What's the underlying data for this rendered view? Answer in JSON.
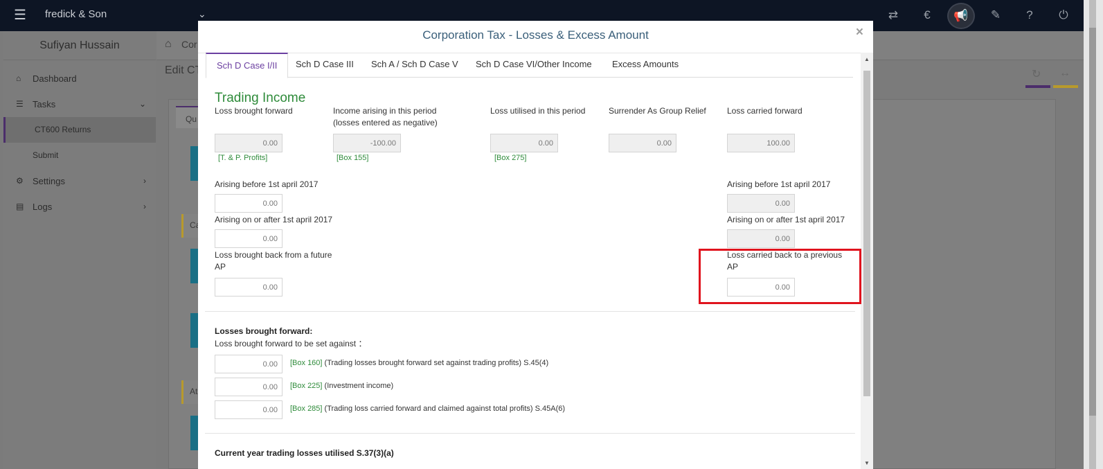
{
  "topbar": {
    "company": "fredick & Son"
  },
  "sidebar": {
    "user": "Sufiyan Hussain",
    "items": [
      {
        "label": "Dashboard"
      },
      {
        "label": "Tasks"
      },
      {
        "label": "CT600 Returns"
      },
      {
        "label": "Submit"
      },
      {
        "label": "Settings"
      },
      {
        "label": "Logs"
      }
    ]
  },
  "background": {
    "crumb": "Cor",
    "edit": "Edit CT",
    "tab": "Qu",
    "card1": "Ca",
    "card2": "At"
  },
  "modal": {
    "title": "Corporation Tax - Losses & Excess Amount",
    "close": "×",
    "tabs": [
      {
        "label": "Sch D Case I/II"
      },
      {
        "label": "Sch D Case III"
      },
      {
        "label": "Sch A / Sch D Case V"
      },
      {
        "label": "Sch D Case VI/Other Income"
      },
      {
        "label": "Excess Amounts"
      }
    ],
    "section_title": "Trading Income",
    "headers": {
      "loss_bf": "Loss brought forward",
      "income_arising_1": "Income arising in this period",
      "income_arising_2": "(losses entered as negative)",
      "loss_utilised": "Loss utilised in this period",
      "surrender": "Surrender As Group Relief",
      "loss_cf": "Loss carried forward"
    },
    "values": {
      "loss_bf": "0.00",
      "income_arising": "-100.00",
      "loss_utilised": "0.00",
      "surrender": "0.00",
      "loss_cf": "100.00",
      "arising_before_left": "0.00",
      "arising_after_left": "0.00",
      "loss_back_future": "0.00",
      "arising_before_right": "0.00",
      "arising_after_right": "0.00",
      "loss_back_previous": "0.00",
      "box160": "0.00",
      "box225": "0.00",
      "box285": "0.00"
    },
    "boxes": {
      "tp_profits": "[T. & P. Profits]",
      "box155": "[Box 155]",
      "box275": "[Box 275]"
    },
    "labels": {
      "arising_before": "Arising before 1st april 2017",
      "arising_after": "Arising on or after 1st april 2017",
      "loss_back_future_1": "Loss brought back from a future",
      "loss_back_future_2": "AP",
      "loss_back_previous_1": "Loss carried back to a previous",
      "loss_back_previous_2": "AP"
    },
    "losses_bf": {
      "title": "Losses brought forward:",
      "subtitle": "Loss brought forward to be set against ：",
      "rows": [
        {
          "box": "[Box 160]",
          "text": " (Trading losses brought forward set against trading profits) S.45(4)"
        },
        {
          "box": "[Box 225]",
          "text": " (Investment income)"
        },
        {
          "box": "[Box 285]",
          "text": " (Trading loss carried forward and claimed against total profits) S.45A(6)"
        }
      ]
    },
    "current_year_title": "Current year trading losses utilised S.37(3)(a)"
  },
  "colors": {
    "accent": "#6b3fa0",
    "green": "#2e8b3a",
    "highlight": "#e0141e",
    "title": "#3a5f7a"
  }
}
